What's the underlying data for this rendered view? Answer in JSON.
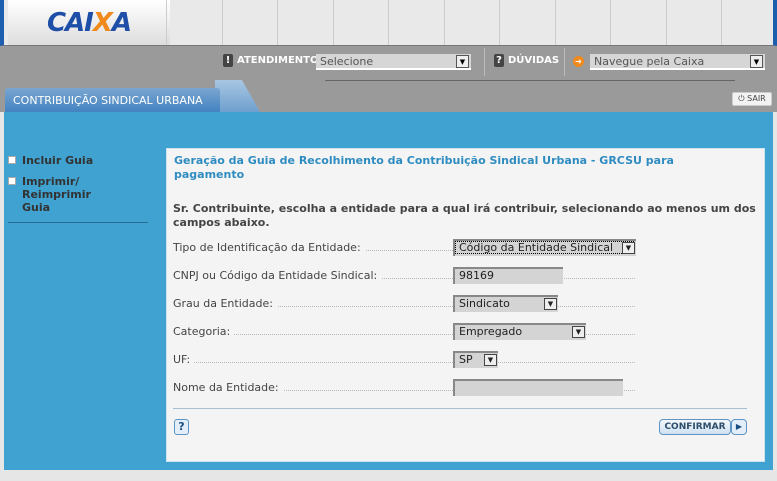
{
  "header": {
    "logo": "CAIXA",
    "atendimento_label": "ATENDIMENTO",
    "atendimento_value": "Selecione",
    "duvidas_label": "DÚVIDAS",
    "navegue_value": "Navegue pela Caixa",
    "sair": "SAIR"
  },
  "tab": {
    "label": "CONTRIBUIÇÃO SINDICAL URBANA"
  },
  "sidebar": {
    "items": [
      {
        "label": "Incluir Guia"
      },
      {
        "label": "Imprimir/ Reimprimir Guia"
      }
    ]
  },
  "form": {
    "title": "Geração da Guia de Recolhimento da Contribuição Sindical Urbana - GRCSU para pagamento",
    "intro": "Sr. Contribuinte, escolha a entidade para a qual irá contribuir, selecionando ao menos um dos campos abaixo.",
    "fields": [
      {
        "label": "Tipo de Identificação da Entidade:",
        "value": "Código da Entidade Sindical"
      },
      {
        "label": "CNPJ ou Código da Entidade Sindical:",
        "value": "98169"
      },
      {
        "label": "Grau da Entidade:",
        "value": "Sindicato"
      },
      {
        "label": "Categoria:",
        "value": "Empregado"
      },
      {
        "label": "UF:",
        "value": "SP"
      },
      {
        "label": "Nome da Entidade:",
        "value": ""
      }
    ],
    "help": "?",
    "confirm": "CONFIRMAR"
  },
  "colors": {
    "brand_blue": "#1d4ea8",
    "brand_orange": "#f08a1c",
    "panel_blue": "#3fa2d0"
  }
}
